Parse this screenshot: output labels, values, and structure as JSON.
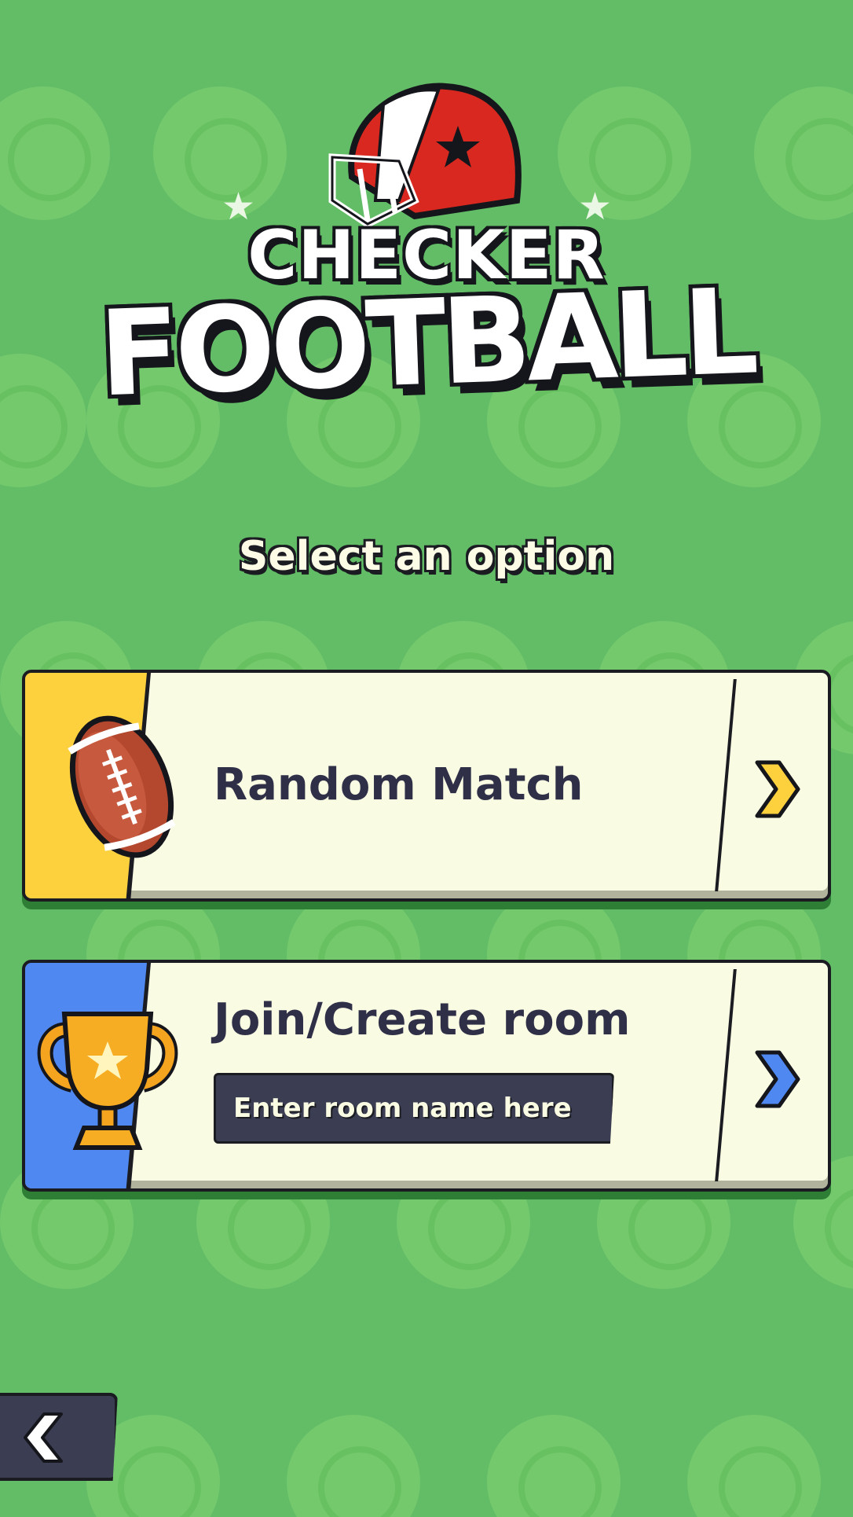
{
  "logo": {
    "line1": "CHECKER",
    "line2": "FOOTBALL"
  },
  "subtitle": "Select an option",
  "options": [
    {
      "label": "Random Match",
      "icon": "football-icon",
      "accent": "#fdd13e",
      "arrow_color": "#fdd13e"
    },
    {
      "label": "Join/Create room",
      "icon": "trophy-icon",
      "accent": "#4f88f0",
      "arrow_color": "#4f88f0",
      "input_placeholder": "Enter room name here",
      "input_value": ""
    }
  ],
  "back_button": {
    "icon": "chevron-left-icon"
  },
  "colors": {
    "background": "#62bd66",
    "card": "#f9fbe3",
    "dark": "#1b1b22",
    "text": "#2f3048"
  }
}
